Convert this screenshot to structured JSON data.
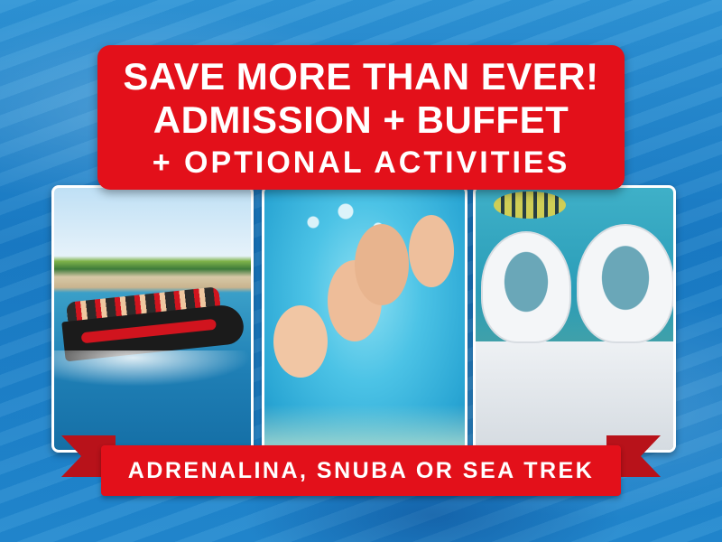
{
  "headline": {
    "line1": "SAVE MORE THAN EVER!",
    "line2": "ADMISSION + BUFFET",
    "line3": "+ OPTIONAL ACTIVITIES"
  },
  "ribbon": {
    "text": "ADRENALINA, SNUBA OR SEA TREK"
  },
  "colors": {
    "accent_red": "#e3101a",
    "ribbon_dark_red": "#b8121a",
    "background_blue": "#1a7cc5"
  }
}
